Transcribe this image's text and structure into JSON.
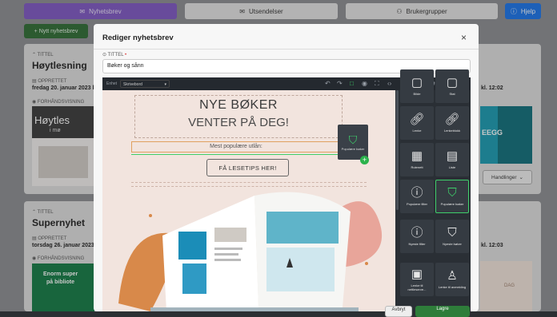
{
  "topbar": {
    "tab_newsletters": "Nyhetsbrev",
    "tab_sendouts": "Utsendelser",
    "tab_usergroups": "Brukergrupper",
    "help": "Hjelp"
  },
  "new_newsletter_button": "+ Nytt nyhetsbrev",
  "cards": [
    {
      "title_label": "TITTEL",
      "title": "Høytlesning",
      "created_label": "OPPRETTET",
      "created": "fredag 20. januar 2023 kl",
      "preview_label": "FORHÅNDSVISNING",
      "preview_text": "Høytles",
      "preview_sub": "i mø",
      "time": "kl. 12:02",
      "right_text": "EEGG",
      "actions": "Handlinger"
    },
    {
      "title_label": "TITTEL",
      "title": "Supernyhet",
      "created_label": "OPPRETTET",
      "created": "torsdag 26. januar 2023",
      "preview_label": "FORHÅNDSVISNING",
      "preview_text": "Enorm super",
      "preview_sub": "på bibliote",
      "time": "kl. 12:03",
      "right_text": "DAG"
    }
  ],
  "modal": {
    "title": "Rediger nyhetsbrev",
    "close": "×",
    "field_label": "TITTEL",
    "field_value": "Bøker og sånn"
  },
  "editor": {
    "unit_label": "Enhet",
    "unit_value": "Skrivebord",
    "canvas": {
      "heading1": "NYE BØKER",
      "heading2": "VENTER PÅ DEG!",
      "popular_text": "Mest populære utlån:",
      "cta": "FÅ LESETIPS HER!",
      "drag_label": "Populære bøker"
    },
    "panel_items": [
      {
        "label": "Bilde",
        "icon": "image-icon"
      },
      {
        "label": "Stat",
        "icon": "stat-icon"
      },
      {
        "label": "Lenke",
        "icon": "link-icon"
      },
      {
        "label": "Lenkeblokk",
        "icon": "link-block-icon"
      },
      {
        "label": "Rutenett",
        "icon": "grid-icon"
      },
      {
        "label": "Liste",
        "icon": "list-icon"
      },
      {
        "label": "Populære filter",
        "icon": "info-icon"
      },
      {
        "label": "Populære bøker",
        "icon": "basket-icon"
      },
      {
        "label": "Nyeste filter",
        "icon": "info-icon"
      },
      {
        "label": "Nyeste bøker",
        "icon": "basket-icon"
      },
      {
        "label": "Lenke til nettleserve...",
        "icon": "browser-icon"
      },
      {
        "label": "Lenke til avmelding",
        "icon": "unsubscribe-icon"
      }
    ]
  },
  "footer": {
    "cancel": "Avbryt",
    "save": "Lagre"
  },
  "colors": {
    "accent_green": "#2e7d3a",
    "accent_purple": "#7e57c2",
    "help_blue": "#1a73e8",
    "teal": "#2a8f86"
  }
}
